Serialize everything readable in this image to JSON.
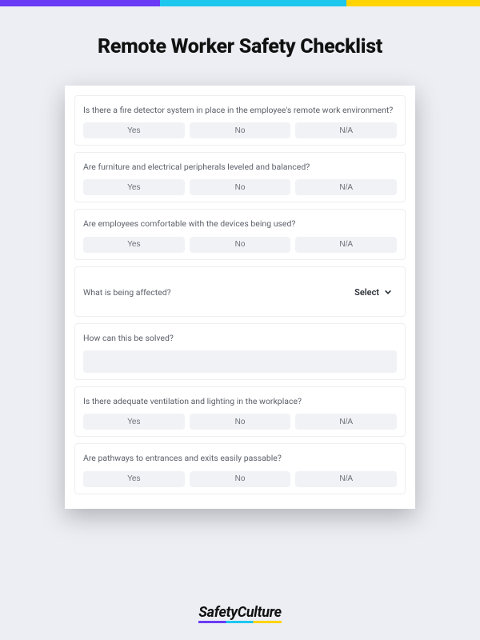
{
  "title": "Remote Worker Safety Checklist",
  "options": {
    "yes": "Yes",
    "no": "No",
    "na": "N/A"
  },
  "select": {
    "label": "Select"
  },
  "questions": [
    {
      "text": "Is there a fire detector system in place in the employee's remote work environment?",
      "type": "yn"
    },
    {
      "text": "Are furniture and electrical peripherals leveled and balanced?",
      "type": "yn"
    },
    {
      "text": "Are employees comfortable with the devices being used?",
      "type": "yn"
    },
    {
      "text": "What is being affected?",
      "type": "select"
    },
    {
      "text": "How can this be solved?",
      "type": "text"
    },
    {
      "text": "Is there adequate ventilation and lighting in the workplace?",
      "type": "yn"
    },
    {
      "text": "Are pathways to entrances and exits easily passable?",
      "type": "yn"
    }
  ],
  "brand": "SafetyCulture"
}
